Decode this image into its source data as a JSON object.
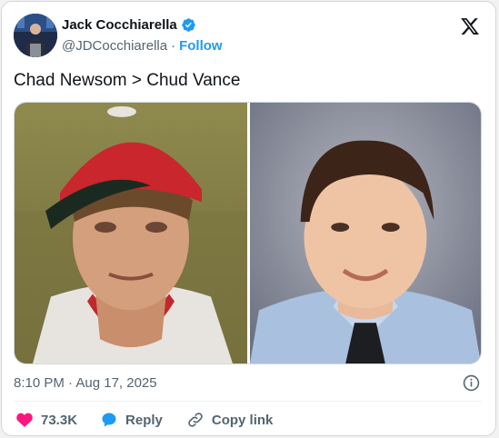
{
  "author": {
    "name": "Jack Cocchiarella",
    "handle": "@JDCocchiarella",
    "separator": "·",
    "follow_label": "Follow",
    "verified": true,
    "avatar_icon": "person-at-podium-avatar"
  },
  "tweet": {
    "text": "Chad Newsom > Chud Vance",
    "timestamp": "8:10 PM · Aug 17, 2025"
  },
  "media": {
    "left_photo": "young man in red baseball cap",
    "right_photo": "young man in blue shirt and tie"
  },
  "actions": {
    "like_count": "73.3K",
    "reply_label": "Reply",
    "copy_link_label": "Copy link"
  },
  "colors": {
    "accent": "#1d9bf0",
    "like": "#f91880",
    "reply": "#1d9bf0",
    "text_secondary": "#536471"
  }
}
